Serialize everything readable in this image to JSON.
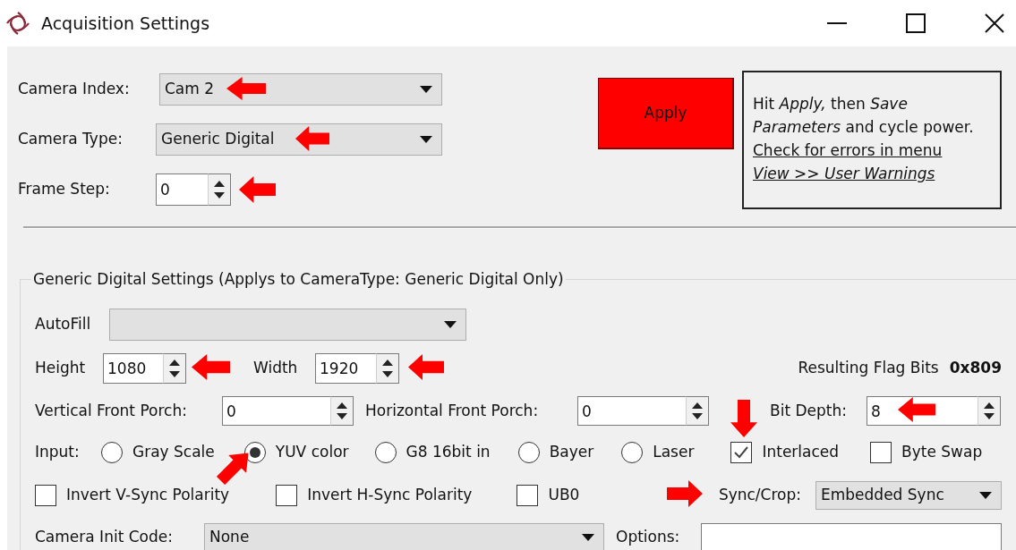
{
  "window": {
    "title": "Acquisition Settings"
  },
  "camera_index": {
    "label": "Camera Index:",
    "value": "Cam 2"
  },
  "camera_type": {
    "label": "Camera Type:",
    "value": "Generic Digital"
  },
  "frame_step": {
    "label": "Frame Step:",
    "value": "0"
  },
  "apply_button": "Apply",
  "notes": {
    "text": "Hit *Apply,* then *Save Parameters* and cycle power.",
    "links": [
      "Check for errors in menu",
      "View >> User Warnings"
    ]
  },
  "generic_group": {
    "title": "Generic Digital Settings (Applys to CameraType: Generic Digital Only)",
    "autofill": {
      "label": "AutoFill"
    },
    "height": {
      "label": "Height",
      "value": "1080"
    },
    "width": {
      "label": "Width",
      "value": "1920"
    },
    "flag_bits": {
      "label": "Resulting Flag Bits",
      "value": "0x809"
    },
    "vertical_front_porch": {
      "label": "Vertical Front Porch:",
      "value": "0"
    },
    "horizontal_front_porch": {
      "label": "Horizontal Front Porch:",
      "value": "0"
    },
    "bit_depth": {
      "label": "Bit Depth:",
      "value": "8"
    },
    "input": {
      "label": "Input:",
      "options": [
        {
          "label": "Gray Scale",
          "selected": false
        },
        {
          "label": "YUV color",
          "selected": true
        },
        {
          "label": "G8 16bit in",
          "selected": false
        },
        {
          "label": "Bayer",
          "selected": false
        },
        {
          "label": "Laser",
          "selected": false
        }
      ]
    },
    "input_checks": [
      {
        "label": "Interlaced",
        "checked": true
      },
      {
        "label": "Byte Swap",
        "checked": false
      }
    ],
    "polarity_checks": [
      {
        "label": "Invert V-Sync Polarity",
        "checked": false
      },
      {
        "label": "Invert H-Sync Polarity",
        "checked": false
      },
      {
        "label": "UB0",
        "checked": false
      }
    ],
    "sync_crop": {
      "label": "Sync/Crop:",
      "value": "Embedded Sync"
    },
    "camera_init_code": {
      "label": "Camera Init Code:",
      "value": "None"
    },
    "options": {
      "label": "Options:"
    }
  }
}
